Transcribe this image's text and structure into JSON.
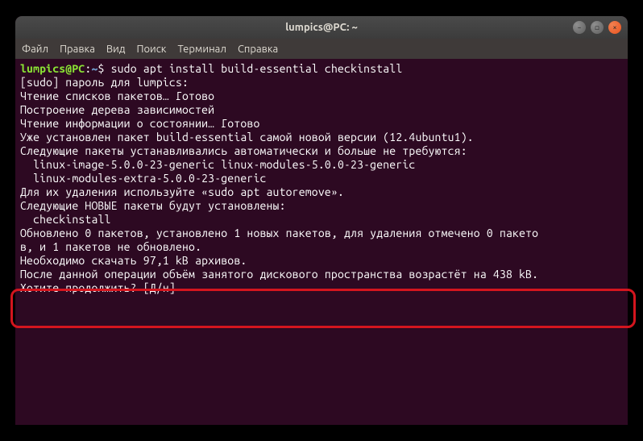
{
  "window": {
    "title": "lumpics@PC: ~"
  },
  "menubar": {
    "items": [
      "Файл",
      "Правка",
      "Вид",
      "Поиск",
      "Терминал",
      "Справка"
    ]
  },
  "prompt": {
    "userhost": "lumpics@PC",
    "colon": ":",
    "path": "~",
    "symbol": "$ "
  },
  "command": "sudo apt install build-essential checkinstall",
  "output": {
    "l1": "[sudo] пароль для lumpics:",
    "l2": "Чтение списков пакетов… Готово",
    "l3": "Построение дерева зависимостей",
    "l4": "Чтение информации о состоянии… Готово",
    "l5": "Уже установлен пакет build-essential самой новой версии (12.4ubuntu1).",
    "l6": "Следующие пакеты устанавливались автоматически и больше не требуются:",
    "l7": "  linux-image-5.0.0-23-generic linux-modules-5.0.0-23-generic",
    "l8": "  linux-modules-extra-5.0.0-23-generic",
    "l9": "Для их удаления используйте «sudo apt autoremove».",
    "l10": "Следующие НОВЫЕ пакеты будут установлены:",
    "l11": "  checkinstall",
    "l12": "Обновлено 0 пакетов, установлено 1 новых пакетов, для удаления отмечено 0 пакето",
    "l13": "в, и 1 пакетов не обновлено.",
    "l14": "Необходимо скачать 97,1 kB архивов.",
    "l15": "После данной операции объём занятого дискового пространства возрастёт на 438 kB.",
    "l16": "Хотите продолжить? [Д/н] "
  }
}
